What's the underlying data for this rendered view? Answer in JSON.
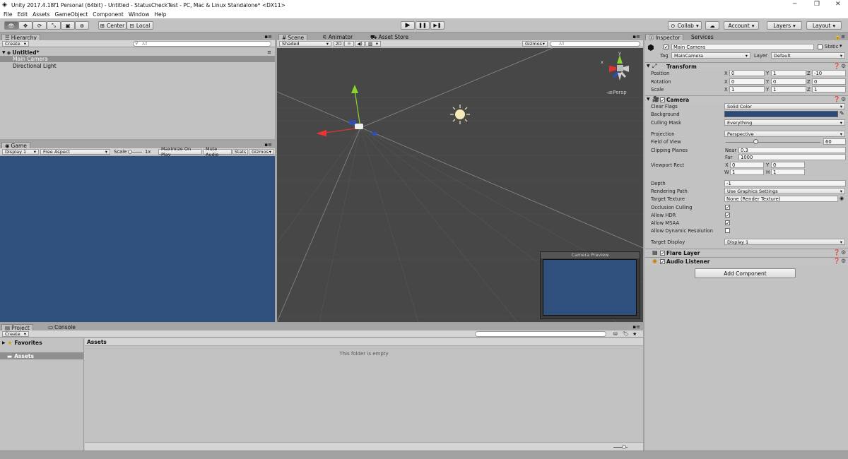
{
  "window": {
    "title": "Unity 2017.4.18f1 Personal (64bit) - Untitled - StatusCheckTest - PC, Mac & Linux Standalone* <DX11>",
    "minimize": "─",
    "maximize": "❐",
    "close": "✕"
  },
  "menu": [
    "File",
    "Edit",
    "Assets",
    "GameObject",
    "Component",
    "Window",
    "Help"
  ],
  "toolbar": {
    "center_label": "Center",
    "local_label": "Local",
    "collab_label": "Collab",
    "account_label": "Account",
    "layers_label": "Layers",
    "layout_label": "Layout",
    "play": "▶",
    "pause": "❚❚",
    "step": "▶❚"
  },
  "hierarchy": {
    "tab": "Hierarchy",
    "create": "Create",
    "search_placeholder": "All",
    "scene_name": "Untitled*",
    "items": [
      "Main Camera",
      "Directional Light"
    ]
  },
  "game": {
    "tab": "Game",
    "display": "Display 1",
    "aspect": "Free Aspect",
    "scale_label": "Scale",
    "scale_value": "1x",
    "maximize": "Maximize On Play",
    "mute": "Mute Audio",
    "stats": "Stats",
    "gizmos": "Gizmos",
    "bg_color": "#2f4f7d"
  },
  "scene": {
    "tabs": [
      "Scene",
      "Animator",
      "Asset Store"
    ],
    "shading": "Shaded",
    "mode_2d": "2D",
    "gizmos": "Gizmos",
    "search_placeholder": "All",
    "persp": "Persp",
    "gizmo_y": "y",
    "gizmo_x": "x",
    "preview_title": "Camera Preview",
    "bg_color": "#474747"
  },
  "project": {
    "tabs": [
      "Project",
      "Console"
    ],
    "create": "Create",
    "favorites": "Favorites",
    "assets_folder": "Assets",
    "assets_header": "Assets",
    "empty_msg": "This folder is empty"
  },
  "inspector": {
    "tabs": [
      "Inspector",
      "Services"
    ],
    "object_name": "Main Camera",
    "static_label": "Static",
    "tag_label": "Tag",
    "tag_value": "MainCamera",
    "layer_label": "Layer",
    "layer_value": "Default",
    "transform": {
      "title": "Transform",
      "position": {
        "label": "Position",
        "x": "0",
        "y": "1",
        "z": "-10"
      },
      "rotation": {
        "label": "Rotation",
        "x": "0",
        "y": "0",
        "z": "0"
      },
      "scale": {
        "label": "Scale",
        "x": "1",
        "y": "1",
        "z": "1"
      }
    },
    "camera": {
      "title": "Camera",
      "clear_flags_label": "Clear Flags",
      "clear_flags": "Solid Color",
      "background_label": "Background",
      "background_color": "#2a4a7a",
      "culling_mask_label": "Culling Mask",
      "culling_mask": "Everything",
      "projection_label": "Projection",
      "projection": "Perspective",
      "fov_label": "Field of View",
      "fov": "60",
      "fov_fraction": 0.3,
      "clipping_label": "Clipping Planes",
      "near_label": "Near",
      "near": "0.3",
      "far_label": "Far",
      "far": "1000",
      "viewport_label": "Viewport Rect",
      "vx": "0",
      "vy": "0",
      "vw": "1",
      "vh": "1",
      "depth_label": "Depth",
      "depth": "-1",
      "rendering_path_label": "Rendering Path",
      "rendering_path": "Use Graphics Settings",
      "target_texture_label": "Target Texture",
      "target_texture": "None (Render Texture)",
      "occlusion_label": "Occlusion Culling",
      "hdr_label": "Allow HDR",
      "msaa_label": "Allow MSAA",
      "dynres_label": "Allow Dynamic Resolution",
      "target_display_label": "Target Display",
      "target_display": "Display 1"
    },
    "flare_layer": "Flare Layer",
    "audio_listener": "Audio Listener",
    "add_component": "Add Component"
  }
}
